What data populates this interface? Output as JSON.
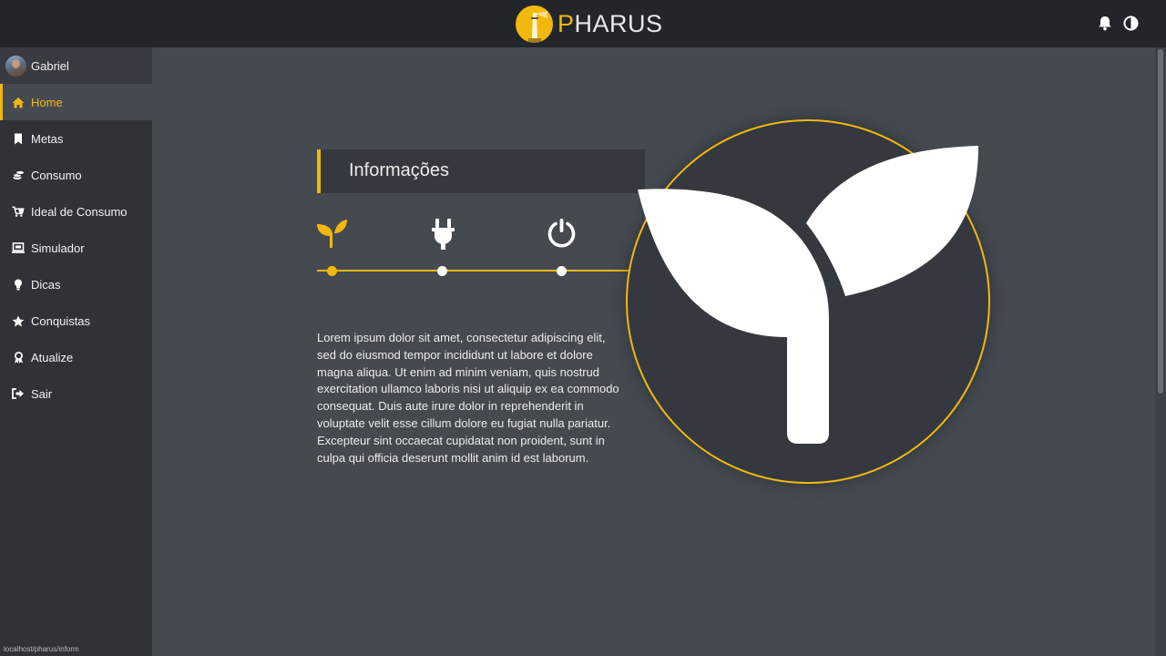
{
  "brand": {
    "first_letter": "P",
    "rest": "HARUS",
    "accent": "#f2b80d"
  },
  "header": {
    "icons": [
      "bell-icon",
      "contrast-icon"
    ]
  },
  "user": {
    "name": "Gabriel"
  },
  "sidebar": {
    "items": [
      {
        "label": "Home",
        "icon": "home-icon",
        "active": true
      },
      {
        "label": "Metas",
        "icon": "bookmark-icon"
      },
      {
        "label": "Consumo",
        "icon": "coins-icon"
      },
      {
        "label": "Ideal de Consumo",
        "icon": "cart-icon"
      },
      {
        "label": "Simulador",
        "icon": "laptop-icon"
      },
      {
        "label": "Dicas",
        "icon": "lightbulb-icon"
      },
      {
        "label": "Conquistas",
        "icon": "star-icon"
      },
      {
        "label": "Atualize",
        "icon": "award-icon"
      },
      {
        "label": "Sair",
        "icon": "sign-out-icon"
      }
    ]
  },
  "main": {
    "section_title": "Informações",
    "timeline": [
      "seedling-icon",
      "plug-icon",
      "power-icon"
    ],
    "body_text": "Lorem ipsum dolor sit amet, consectetur adipiscing elit, sed do eiusmod tempor incididunt ut labore et dolore magna aliqua. Ut enim ad minim veniam, quis nostrud exercitation ullamco laboris nisi ut aliquip ex ea commodo consequat. Duis aute irure dolor in reprehenderit in voluptate velit esse cillum dolore eu fugiat nulla pariatur. Excepteur sint occaecat cupidatat non proident, sunt in culpa qui officia deserunt mollit anim id est laborum."
  },
  "status_bar": {
    "url": "localhost/pharus/inform"
  }
}
